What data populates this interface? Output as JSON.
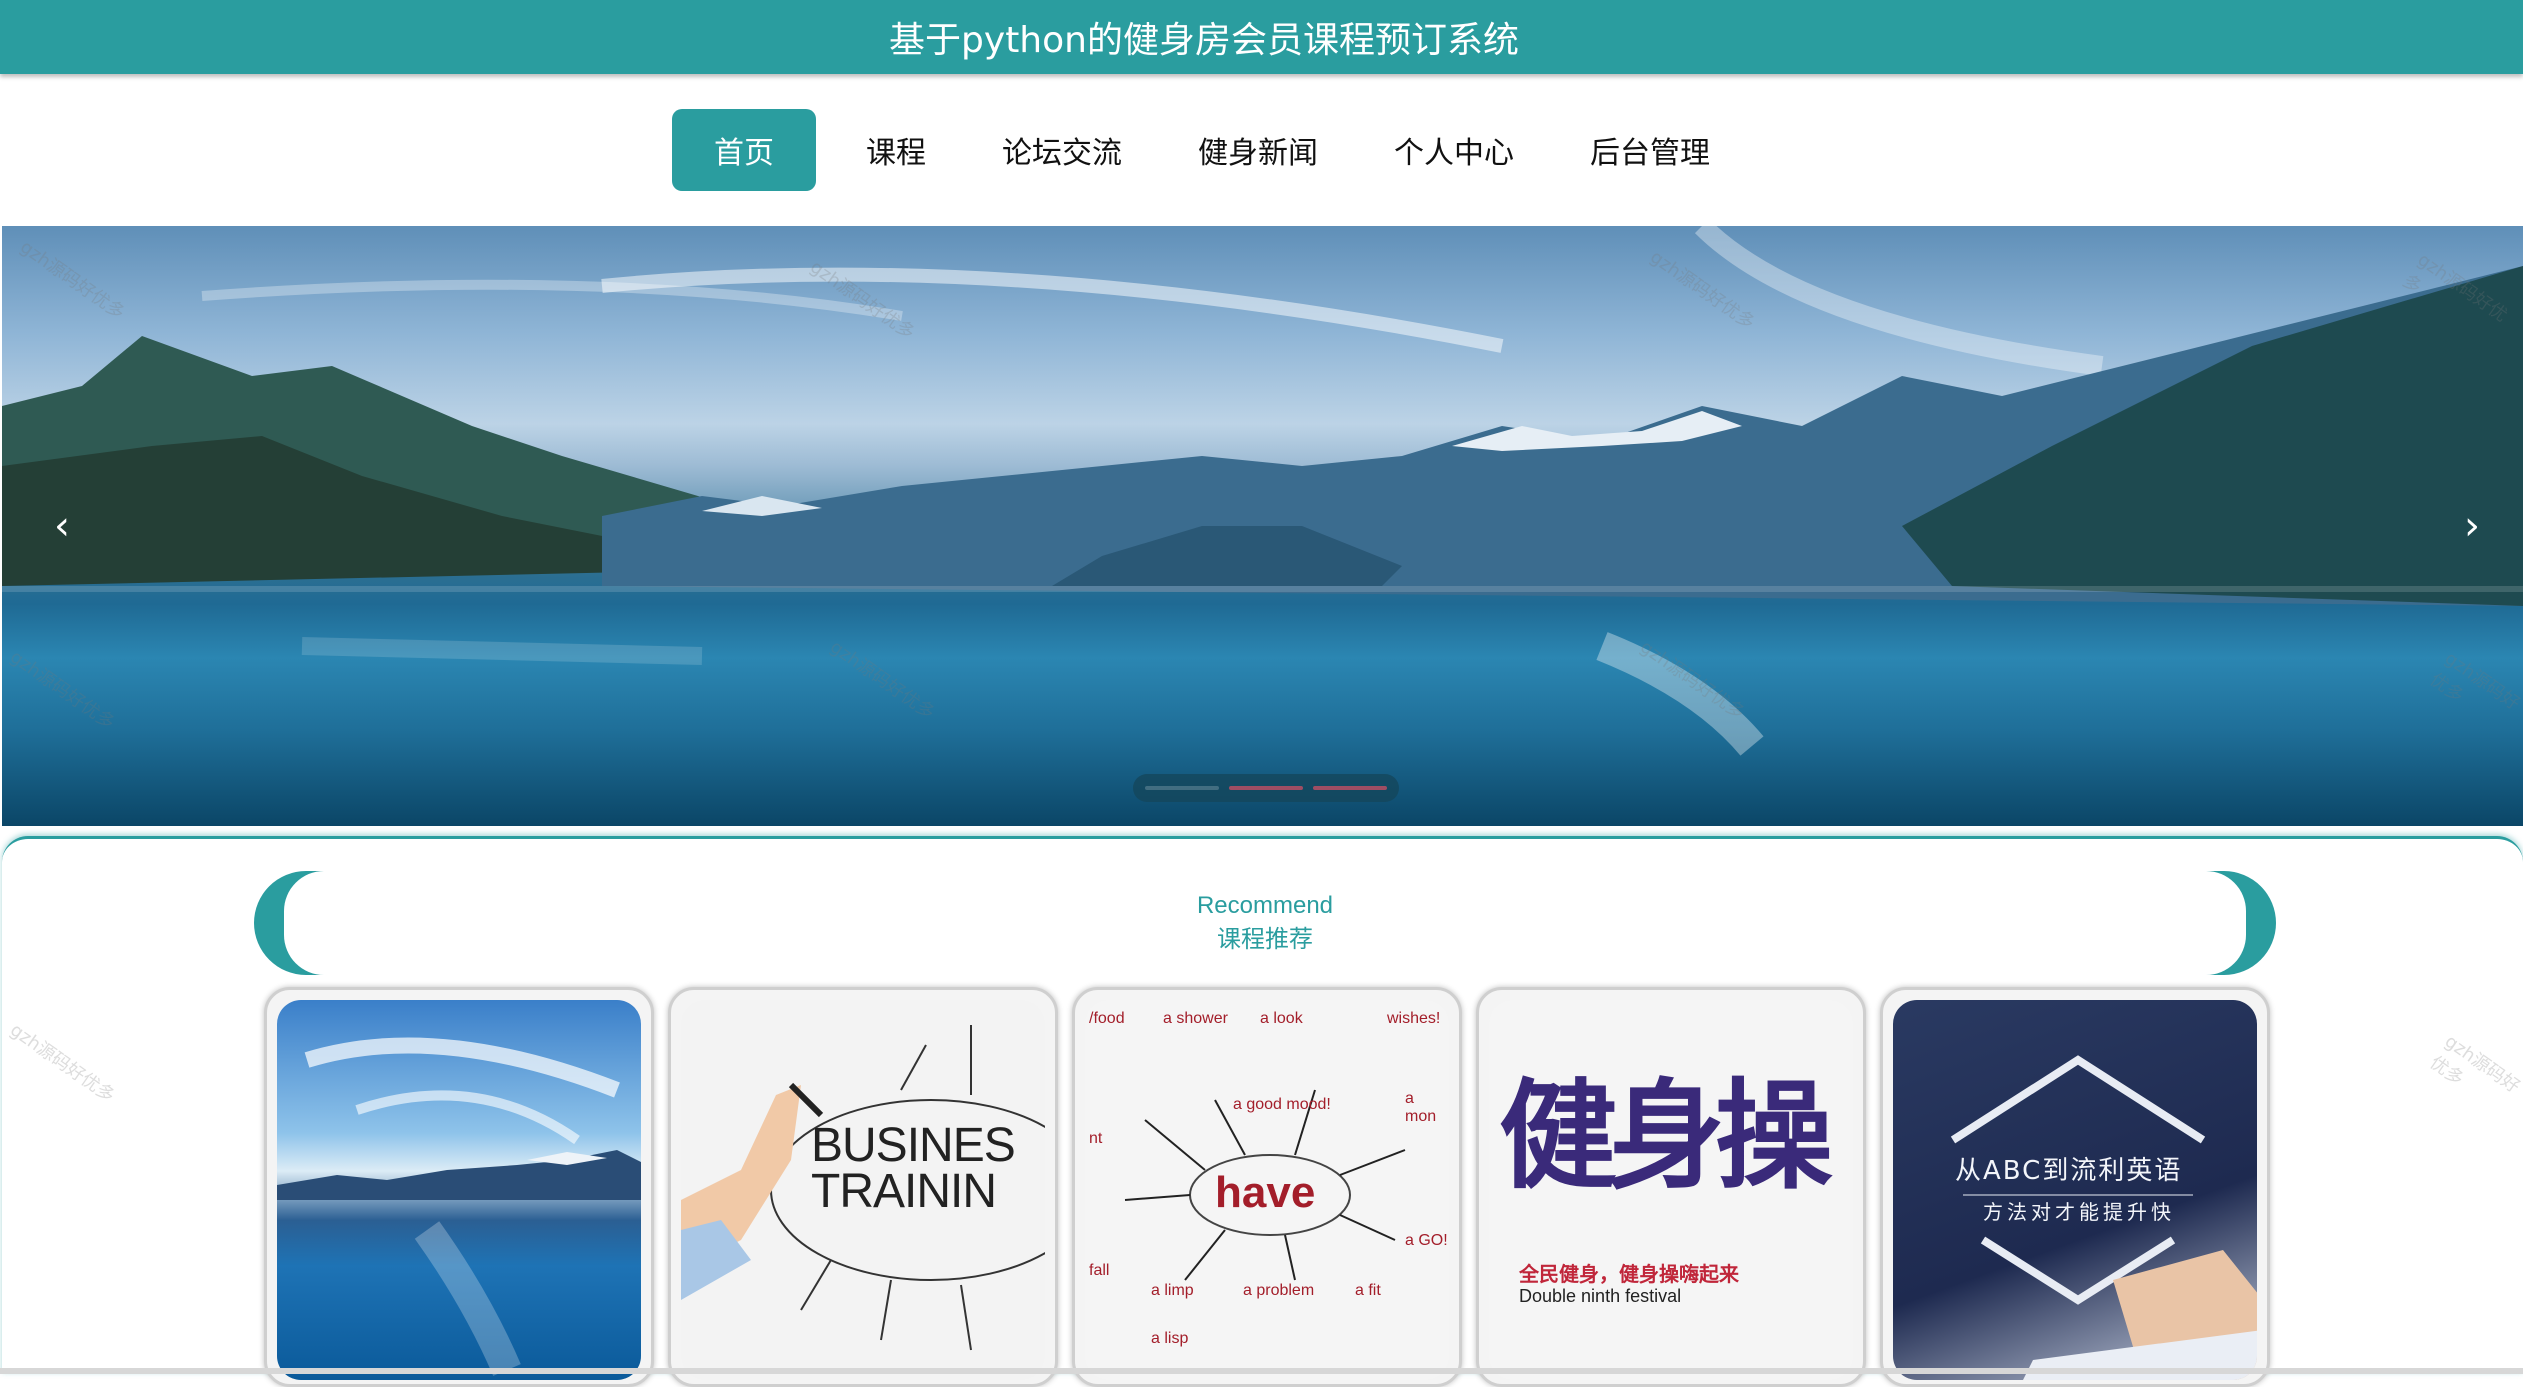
{
  "header": {
    "title": "基于python的健身房会员课程预订系统"
  },
  "nav": {
    "items": [
      {
        "label": "首页",
        "active": true
      },
      {
        "label": "课程",
        "active": false
      },
      {
        "label": "论坛交流",
        "active": false
      },
      {
        "label": "健身新闻",
        "active": false
      },
      {
        "label": "个人中心",
        "active": false
      },
      {
        "label": "后台管理",
        "active": false
      }
    ]
  },
  "banner": {
    "prev_icon": "chevron-left-icon",
    "next_icon": "chevron-right-icon",
    "prev_glyph": "‹",
    "next_glyph": "›",
    "slide_count": 3,
    "active_slide": 1
  },
  "recommend": {
    "title_en": "Recommend",
    "title_cn": "课程推荐",
    "cards": [
      {
        "image": "lake-mountains-image"
      },
      {
        "image": "business-training-image",
        "text_lines": [
          "BUSINES",
          "TRAININ"
        ]
      },
      {
        "image": "have-mindmap-image",
        "center_word": "have",
        "words": [
          "/food",
          "a shower",
          "a look",
          "wishes!",
          "a good mood!",
          "a limp",
          "a problem",
          "a fit",
          "a lisp",
          "a mon",
          "a GO!",
          "nt",
          "fall"
        ]
      },
      {
        "image": "fitness-exercise-image",
        "calligraphy": "健身操",
        "subtitle_cn": "全民健身，健身操嗨起来",
        "subtitle_en": "Double ninth festival"
      },
      {
        "image": "english-learning-image",
        "line1": "从ABC到流利英语",
        "line2": "方法对才能提升快"
      }
    ]
  },
  "watermark": "gzh源码好优多",
  "colors": {
    "accent": "#2a9d9f"
  }
}
